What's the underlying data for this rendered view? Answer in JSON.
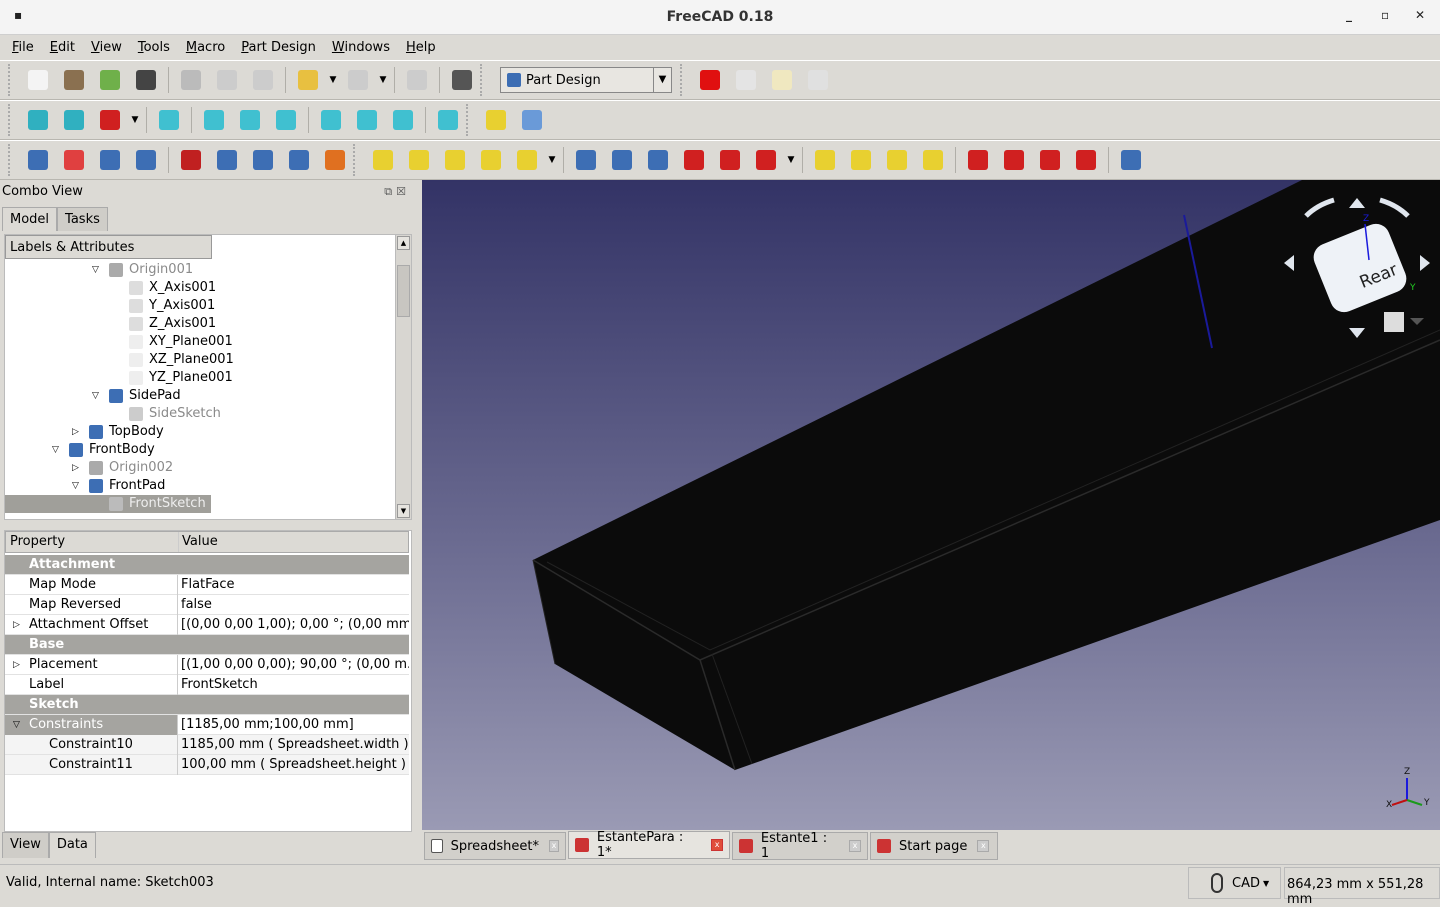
{
  "window": {
    "title": "FreeCAD 0.18",
    "controls": [
      "_",
      "▫",
      "✕"
    ]
  },
  "menu": [
    "File",
    "Edit",
    "View",
    "Tools",
    "Macro",
    "Part Design",
    "Windows",
    "Help"
  ],
  "toolbar1": {
    "icons": [
      {
        "name": "new-icon",
        "color": "#f4f4f4"
      },
      {
        "name": "open-icon",
        "color": "#8a7050"
      },
      {
        "name": "save-icon",
        "color": "#6fb04a"
      },
      {
        "name": "print-icon",
        "color": "#444"
      },
      {
        "name": "cut-icon",
        "color": "#bbb"
      },
      {
        "name": "copy-icon",
        "color": "#ccc"
      },
      {
        "name": "paste-icon",
        "color": "#ccc"
      },
      {
        "name": "undo-icon",
        "color": "#e8c040"
      },
      {
        "name": "redo-icon",
        "color": "#ccc"
      },
      {
        "name": "refresh-icon",
        "color": "#ccc"
      },
      {
        "name": "whats-this-icon",
        "color": "#555"
      }
    ],
    "workbench": "Part Design",
    "macro_icons": [
      {
        "name": "record-macro-icon",
        "color": "#e01010"
      },
      {
        "name": "stop-macro-icon",
        "color": "#e4e4e4"
      },
      {
        "name": "macro-editor-icon",
        "color": "#f0e8c0"
      },
      {
        "name": "run-macro-icon",
        "color": "#e0e0e0"
      }
    ]
  },
  "toolbar2": {
    "icons": [
      {
        "name": "fit-all-icon",
        "color": "#30b0c0"
      },
      {
        "name": "fit-selection-icon",
        "color": "#30b0c0"
      },
      {
        "name": "draw-style-icon",
        "color": "#d02020"
      },
      {
        "name": "isometric-view-icon",
        "color": "#40c0d0"
      },
      {
        "name": "front-view-icon",
        "color": "#40c0d0"
      },
      {
        "name": "top-view-icon",
        "color": "#40c0d0"
      },
      {
        "name": "right-view-icon",
        "color": "#40c0d0"
      },
      {
        "name": "rear-view-icon",
        "color": "#40c0d0"
      },
      {
        "name": "bottom-view-icon",
        "color": "#40c0d0"
      },
      {
        "name": "left-view-icon",
        "color": "#40c0d0"
      },
      {
        "name": "measure-distance-icon",
        "color": "#40c0d0"
      },
      {
        "name": "create-part-icon",
        "color": "#e8d030"
      },
      {
        "name": "create-group-icon",
        "color": "#6a9ad8"
      }
    ]
  },
  "toolbar3": {
    "icons": [
      {
        "name": "create-body-icon",
        "color": "#3d6eb4"
      },
      {
        "name": "create-sketch-icon",
        "color": "#e04040"
      },
      {
        "name": "validate-sketch-icon",
        "color": "#3d6eb4"
      },
      {
        "name": "shape-binder-icon",
        "color": "#3d6eb4"
      },
      {
        "name": "datum-point-icon",
        "color": "#c02020"
      },
      {
        "name": "datum-line-icon",
        "color": "#3d6eb4"
      },
      {
        "name": "datum-plane-icon",
        "color": "#3d6eb4"
      },
      {
        "name": "local-cs-icon",
        "color": "#3d6eb4"
      },
      {
        "name": "clone-icon",
        "color": "#e07020"
      },
      {
        "name": "pad-icon",
        "color": "#e8d030"
      },
      {
        "name": "revolution-icon",
        "color": "#e8d030"
      },
      {
        "name": "additive-loft-icon",
        "color": "#e8d030"
      },
      {
        "name": "additive-pipe-icon",
        "color": "#e8d030"
      },
      {
        "name": "additive-primitive-icon",
        "color": "#e8d030"
      },
      {
        "name": "pocket-icon",
        "color": "#3d6eb4"
      },
      {
        "name": "hole-icon",
        "color": "#3d6eb4"
      },
      {
        "name": "groove-icon",
        "color": "#3d6eb4"
      },
      {
        "name": "subtractive-loft-icon",
        "color": "#d02020"
      },
      {
        "name": "subtractive-pipe-icon",
        "color": "#d02020"
      },
      {
        "name": "subtractive-primitive-icon",
        "color": "#d02020"
      },
      {
        "name": "mirrored-icon",
        "color": "#e8d030"
      },
      {
        "name": "linear-pattern-icon",
        "color": "#e8d030"
      },
      {
        "name": "polar-pattern-icon",
        "color": "#e8d030"
      },
      {
        "name": "multi-transform-icon",
        "color": "#e8d030"
      },
      {
        "name": "fillet-icon",
        "color": "#d02020"
      },
      {
        "name": "chamfer-icon",
        "color": "#d02020"
      },
      {
        "name": "draft-icon",
        "color": "#d02020"
      },
      {
        "name": "thickness-icon",
        "color": "#d02020"
      },
      {
        "name": "boolean-icon",
        "color": "#3d6eb4"
      }
    ]
  },
  "combo": {
    "title": "Combo View",
    "tabs": [
      "Model",
      "Tasks"
    ],
    "bottom_tabs": [
      "View",
      "Data"
    ]
  },
  "tree": {
    "header": "Labels & Attributes",
    "items": [
      {
        "label": "Origin001",
        "depth": 3,
        "exp": "open",
        "icon": "origin-icon",
        "grey": true,
        "color": "#aaa"
      },
      {
        "label": "X_Axis001",
        "depth": 4,
        "icon": "axis-icon",
        "color": "#ddd"
      },
      {
        "label": "Y_Axis001",
        "depth": 4,
        "icon": "axis-icon",
        "color": "#ddd"
      },
      {
        "label": "Z_Axis001",
        "depth": 4,
        "icon": "axis-icon",
        "color": "#ddd"
      },
      {
        "label": "XY_Plane001",
        "depth": 4,
        "icon": "plane-icon",
        "color": "#eee"
      },
      {
        "label": "XZ_Plane001",
        "depth": 4,
        "icon": "plane-icon",
        "color": "#eee"
      },
      {
        "label": "YZ_Plane001",
        "depth": 4,
        "icon": "plane-icon",
        "color": "#eee"
      },
      {
        "label": "SidePad",
        "depth": 3,
        "exp": "open",
        "icon": "pad-icon",
        "color": "#3d6eb4"
      },
      {
        "label": "SideSketch",
        "depth": 4,
        "icon": "sketch-icon",
        "grey": true,
        "color": "#ccc"
      },
      {
        "label": "TopBody",
        "depth": 2,
        "exp": "closed",
        "icon": "body-icon",
        "color": "#3d6eb4"
      },
      {
        "label": "FrontBody",
        "depth": 1,
        "exp": "open",
        "icon": "body-icon",
        "color": "#3d6eb4"
      },
      {
        "label": "Origin002",
        "depth": 2,
        "exp": "closed",
        "icon": "origin-icon",
        "grey": true,
        "color": "#aaa"
      },
      {
        "label": "FrontPad",
        "depth": 2,
        "exp": "open",
        "icon": "pad-icon",
        "color": "#3d6eb4"
      },
      {
        "label": "FrontSketch",
        "depth": 3,
        "icon": "sketch-icon",
        "selected": true,
        "color": "#bbb"
      }
    ]
  },
  "properties": {
    "headers": [
      "Property",
      "Value"
    ],
    "rows": [
      {
        "type": "group",
        "name": "Attachment"
      },
      {
        "name": "Map Mode",
        "value": "FlatFace"
      },
      {
        "name": "Map Reversed",
        "value": "false"
      },
      {
        "name": "Attachment Offset",
        "value": "[(0,00 0,00 1,00); 0,00 °; (0,00 mm...",
        "exp": "closed"
      },
      {
        "type": "group",
        "name": "Base"
      },
      {
        "name": "Placement",
        "value": "[(1,00 0,00 0,00); 90,00 °; (0,00 m...",
        "exp": "closed"
      },
      {
        "name": "Label",
        "value": "FrontSketch"
      },
      {
        "type": "group",
        "name": "Sketch"
      },
      {
        "name": "Constraints",
        "value": "[1185,00 mm;100,00 mm]",
        "exp": "open",
        "selgroup": true
      },
      {
        "name": "Constraint10",
        "value": "1185,00 mm  ( Spreadsheet.width )",
        "sub": true
      },
      {
        "name": "Constraint11",
        "value": "100,00 mm  ( Spreadsheet.height )",
        "sub": true
      }
    ]
  },
  "navcube": {
    "face": "Rear",
    "axes": [
      "Z",
      "Y",
      "X"
    ]
  },
  "doc_tabs": [
    {
      "label": "Spreadsheet*",
      "icon": "spreadsheet-icon",
      "active": false
    },
    {
      "label": "EstantePara : 1*",
      "icon": "freecad-doc-icon",
      "active": true
    },
    {
      "label": "Estante1 : 1",
      "icon": "freecad-doc-icon",
      "active": false
    },
    {
      "label": "Start page",
      "icon": "freecad-doc-icon",
      "active": false
    }
  ],
  "status": {
    "message": "Valid, Internal name: Sketch003",
    "nav_style": "CAD",
    "dimensions": "864,23 mm x 551,28 mm"
  }
}
